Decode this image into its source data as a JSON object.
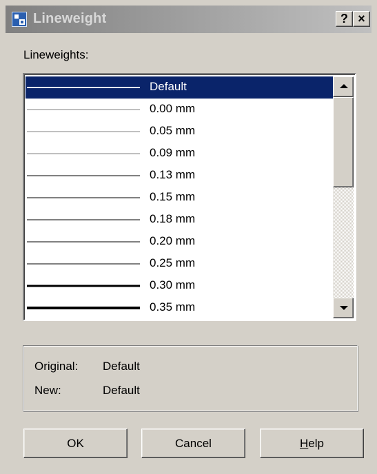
{
  "window": {
    "title": "Lineweight",
    "help_glyph": "?",
    "close_glyph": "×"
  },
  "list": {
    "label": "Lineweights:",
    "selected_index": 0,
    "items": [
      {
        "label": "Default",
        "weight": 2
      },
      {
        "label": "0.00 mm",
        "weight": 1
      },
      {
        "label": "0.05 mm",
        "weight": 1
      },
      {
        "label": "0.09 mm",
        "weight": 1
      },
      {
        "label": "0.13 mm",
        "weight": 2
      },
      {
        "label": "0.15 mm",
        "weight": 2
      },
      {
        "label": "0.18 mm",
        "weight": 2
      },
      {
        "label": "0.20 mm",
        "weight": 2
      },
      {
        "label": "0.25 mm",
        "weight": 2
      },
      {
        "label": "0.30 mm",
        "weight": 3
      },
      {
        "label": "0.35 mm",
        "weight": 4
      }
    ]
  },
  "info": {
    "original_label": "Original:",
    "original_value": "Default",
    "new_label": "New:",
    "new_value": "Default"
  },
  "buttons": {
    "ok": "OK",
    "cancel": "Cancel",
    "help_accel": "H",
    "help_rest": "elp"
  },
  "icons": {
    "app": "lineweight-app-icon",
    "scroll_up": "scroll-up-arrow-icon",
    "scroll_down": "scroll-down-arrow-icon"
  },
  "colors": {
    "dialog_bg": "#d4d0c8",
    "selection": "#0a246a",
    "title_gradient_start": "#808080",
    "title_gradient_end": "#c0c0c0"
  }
}
